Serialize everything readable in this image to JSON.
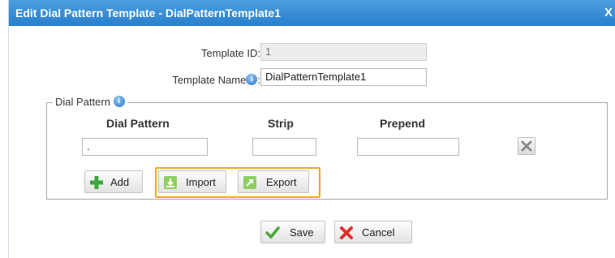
{
  "dialog": {
    "title": "Edit Dial Pattern Template - DialPatternTemplate1",
    "close_label": "X"
  },
  "form": {
    "template_id_label": "Template ID:",
    "template_id_value": "1",
    "template_name_label": "Template Name",
    "template_name_colon": ":",
    "template_name_value": "DialPatternTemplate1"
  },
  "dial_pattern": {
    "legend": "Dial Pattern",
    "columns": [
      "Dial Pattern",
      "Strip",
      "Prepend"
    ],
    "row": {
      "pattern": ".",
      "strip": "",
      "prepend": ""
    },
    "buttons": {
      "add": "Add",
      "import": "Import",
      "export": "Export"
    }
  },
  "footer": {
    "save": "Save",
    "cancel": "Cancel"
  },
  "icons": {
    "info": "info-icon",
    "delete": "delete-x-icon",
    "add": "plus-icon",
    "import": "import-icon",
    "export": "export-icon",
    "save": "checkmark-icon",
    "cancel": "red-x-icon"
  },
  "colors": {
    "titlebar": "#3a8fd8",
    "highlight": "#f0a818"
  }
}
